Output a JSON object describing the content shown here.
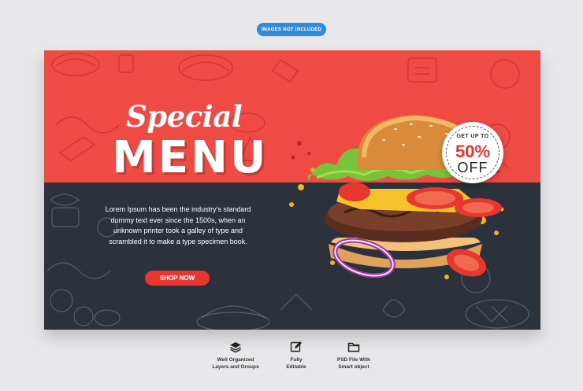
{
  "notice": {
    "text": "IMAGES NOT INCLUDED"
  },
  "banner": {
    "title_script": "Special",
    "title_main": "MENU",
    "description": "Lorem Ipsum has been the industry's standard dummy text ever since the 1500s, when an unknown printer took a galley of type and scrambled it to make a type specimen book.",
    "cta_label": "SHOP NOW",
    "badge": {
      "top": "GET UP TO",
      "percent": "50%",
      "off": "OFF"
    }
  },
  "features": [
    {
      "icon": "layers-icon",
      "label": "Well Organized\nLayers and Groups"
    },
    {
      "icon": "edit-icon",
      "label": "Fully\nEditable"
    },
    {
      "icon": "folder-icon",
      "label": "PSD File With\nSmart object"
    }
  ],
  "colors": {
    "background": "#e8e8ea",
    "notice_pill": "#2d8cde",
    "banner_red": "#ef4a44",
    "banner_dark": "#2b323b",
    "accent_red": "#e7372f"
  }
}
